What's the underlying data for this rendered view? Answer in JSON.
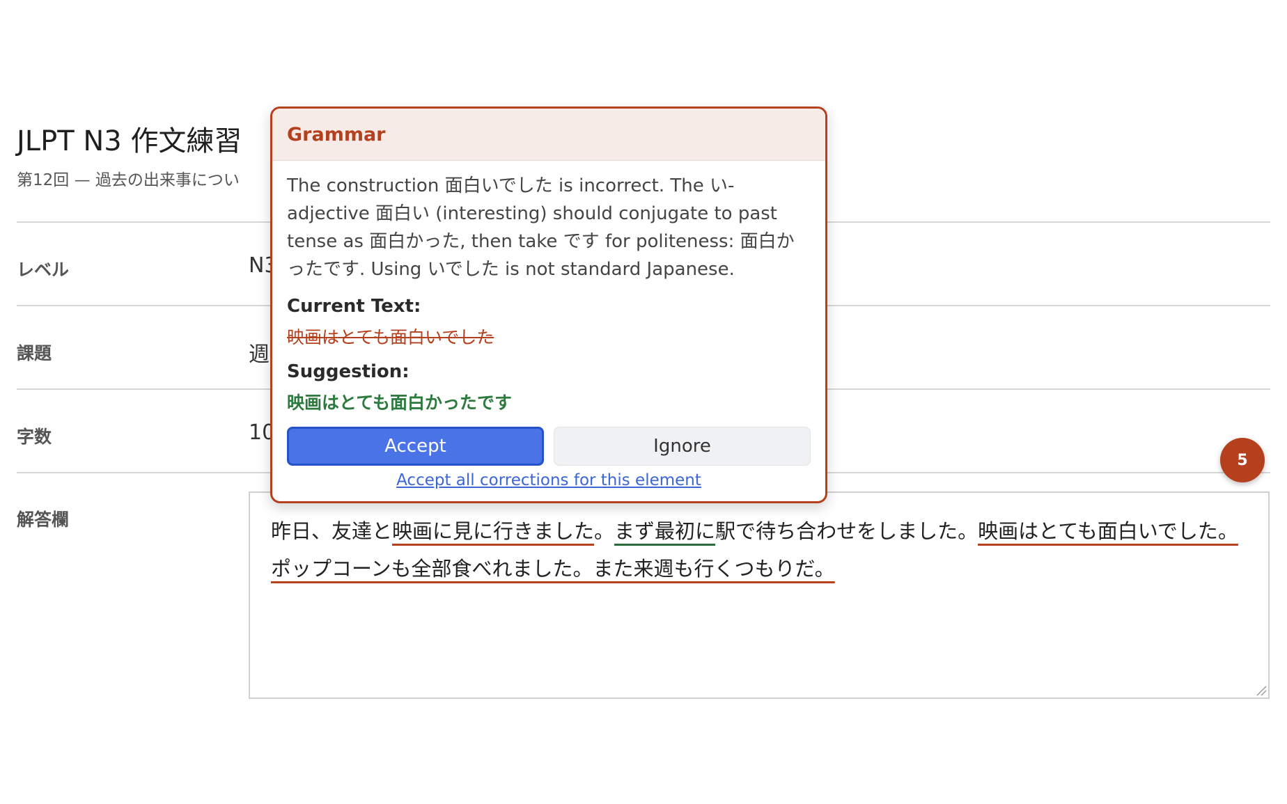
{
  "page": {
    "title": "JLPT N3 作文練習",
    "subtitle": "第12回 — 過去の出来事につい"
  },
  "rows": {
    "level": {
      "label": "レベル",
      "value": "N3"
    },
    "topic": {
      "label": "課題",
      "value": "週"
    },
    "chars": {
      "label": "字数",
      "value": "10"
    },
    "answer": {
      "label": "解答欄"
    }
  },
  "answer": {
    "seg1": "昨日、友達と",
    "seg2": "映画に見に行きました",
    "seg3": "。",
    "seg4": "まず最初に",
    "seg5": "駅で待ち合わせをしました。",
    "seg6": "映画はとても面白いでした。ポップコーンも全部食べれました。また来週も行くつもりだ。"
  },
  "badge": {
    "count": "5"
  },
  "popover": {
    "type": "Grammar",
    "explanation": "The construction 面白いでした is incorrect. The い-adjective 面白い (interesting) should conjugate to past tense as 面白かった, then take です for politeness: 面白かったです. Using いでした is not standard Japanese.",
    "current_label": "Current Text:",
    "current_text": "映画はとても面白いでした",
    "suggestion_label": "Suggestion:",
    "suggestion_text": "映画はとても面白かったです",
    "accept_label": "Accept",
    "ignore_label": "Ignore",
    "accept_all_label": "Accept all corrections for this element"
  },
  "colors": {
    "grammar": "#b5401d",
    "suggestion": "#2d7a3e",
    "accept": "#4a73e8"
  }
}
